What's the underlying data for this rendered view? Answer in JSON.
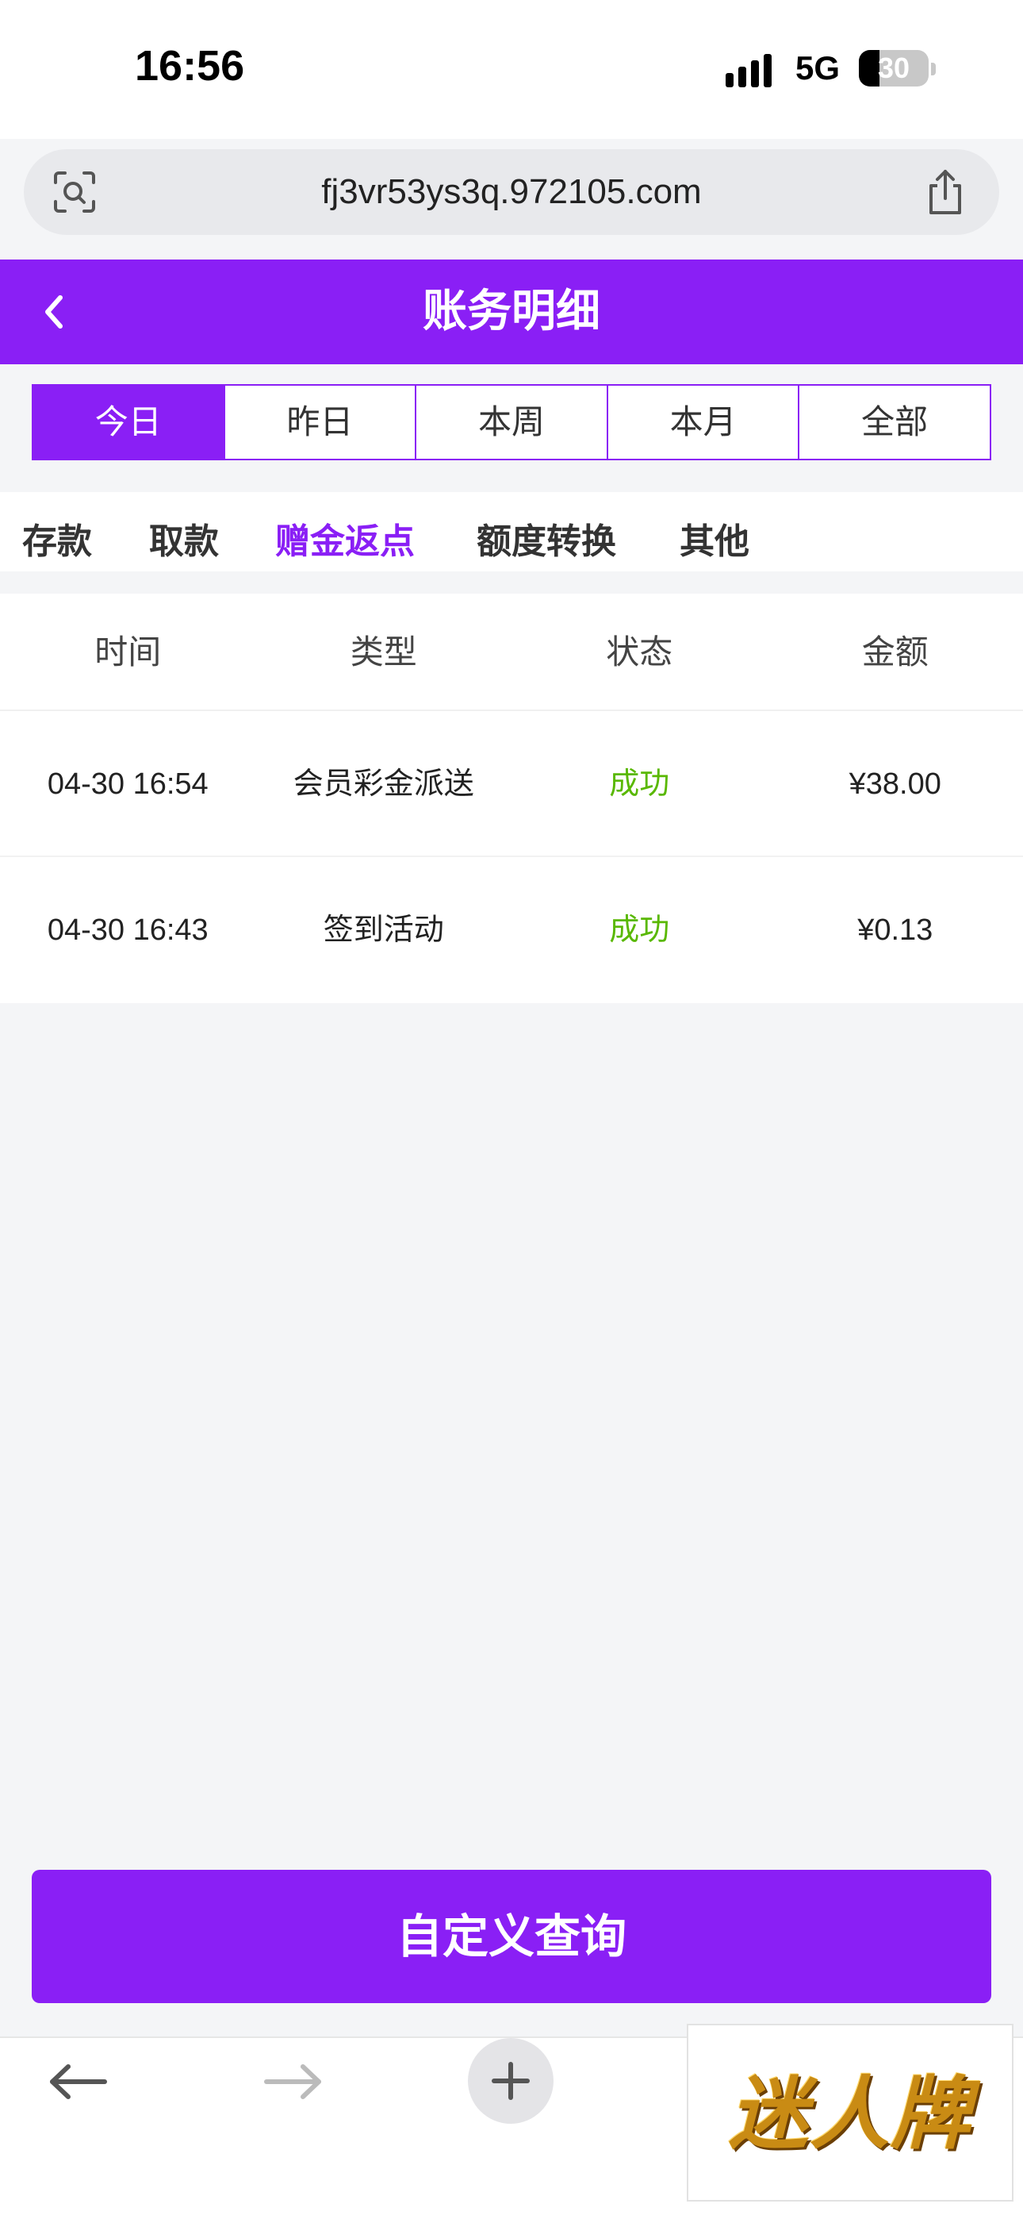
{
  "status_bar": {
    "time": "16:56",
    "network": "5G",
    "battery": "30",
    "battery_level_percent": 30
  },
  "browser": {
    "url": "fj3vr53ys3q.972105.com",
    "lens_icon": "camera-search-icon",
    "share_icon": "share-icon"
  },
  "header": {
    "title": "账务明细",
    "back_icon": "chevron-left-icon"
  },
  "date_tabs": [
    {
      "label": "今日",
      "active": true
    },
    {
      "label": "昨日",
      "active": false
    },
    {
      "label": "本周",
      "active": false
    },
    {
      "label": "本月",
      "active": false
    },
    {
      "label": "全部",
      "active": false
    }
  ],
  "category_tabs": [
    {
      "label": "存款",
      "active": false
    },
    {
      "label": "取款",
      "active": false
    },
    {
      "label": "赠金返点",
      "active": true
    },
    {
      "label": "额度转换",
      "active": false
    },
    {
      "label": "其他",
      "active": false
    }
  ],
  "table": {
    "columns": [
      "时间",
      "类型",
      "状态",
      "金额"
    ],
    "rows": [
      {
        "time": "04-30 16:54",
        "type": "会员彩金派送",
        "status": "成功",
        "amount": "¥38.00"
      },
      {
        "time": "04-30 16:43",
        "type": "签到活动",
        "status": "成功",
        "amount": "¥0.13"
      }
    ]
  },
  "query_button": "自定义查询",
  "bottom_bar": {
    "back_icon": "arrow-left-icon",
    "forward_icon": "arrow-right-icon",
    "new_tab_icon": "plus-icon",
    "logo_text": "迷人牌"
  },
  "colors": {
    "accent": "#8a1ff5",
    "success": "#59b800",
    "background": "#f4f5f7"
  }
}
